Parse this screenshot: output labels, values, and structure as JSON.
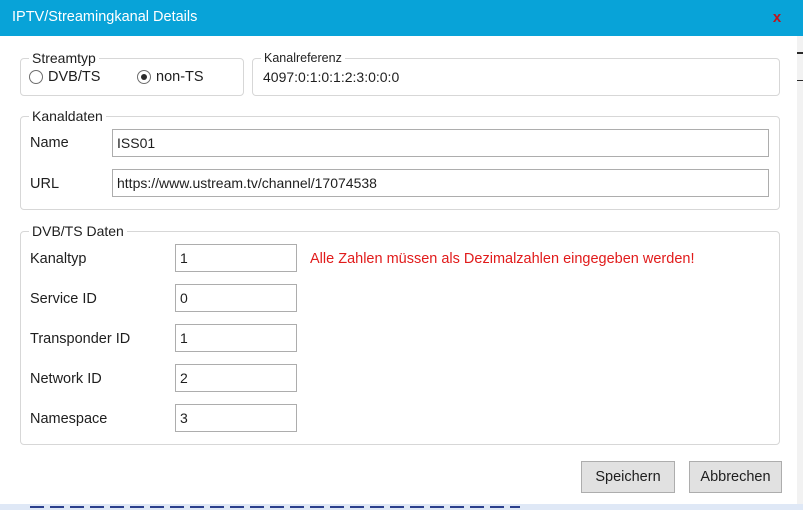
{
  "window": {
    "title": "IPTV/Streamingkanal Details",
    "close_glyph": "x",
    "title_bg": "#08a3d8",
    "close_color": "#c0141c"
  },
  "streamtyp": {
    "legend": "Streamtyp",
    "options": [
      {
        "label": "DVB/TS",
        "selected": false
      },
      {
        "label": "non-TS",
        "selected": true
      }
    ]
  },
  "kanalreferenz": {
    "legend": "Kanalreferenz",
    "value": "4097:0:1:0:1:2:3:0:0:0"
  },
  "kanaldaten": {
    "legend": "Kanaldaten",
    "name_label": "Name",
    "name_value": "ISS01",
    "url_label": "URL",
    "url_value": "https://www.ustream.tv/channel/17074538"
  },
  "dvbts": {
    "legend": "DVB/TS Daten",
    "warning": "Alle Zahlen müssen als Dezimalzahlen eingegeben werden!",
    "warning_color": "#e11b1b",
    "fields": [
      {
        "label": "Kanaltyp",
        "value": "1"
      },
      {
        "label": "Service ID",
        "value": "0"
      },
      {
        "label": "Transponder ID",
        "value": "1"
      },
      {
        "label": "Network ID",
        "value": "2"
      },
      {
        "label": "Namespace",
        "value": "3"
      }
    ]
  },
  "buttons": {
    "save": "Speichern",
    "cancel": "Abbrechen"
  },
  "icons": {
    "close": "close-icon"
  }
}
